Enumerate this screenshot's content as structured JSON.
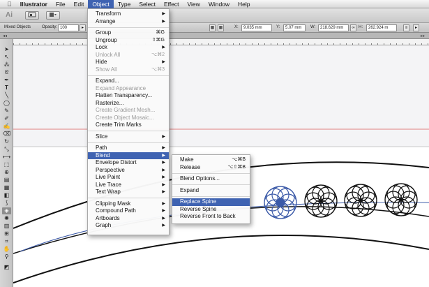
{
  "menubar": {
    "apple": "",
    "items": [
      "Illustrator",
      "File",
      "Edit",
      "Object",
      "Type",
      "Select",
      "Effect",
      "View",
      "Window",
      "Help"
    ],
    "active": "Object"
  },
  "appbar": {
    "logo": "Ai"
  },
  "controlbar": {
    "selection": "Mixed Objects",
    "opacity_label": "Opacity:",
    "opacity_value": "100",
    "x_label": "X:",
    "x_value": "9.035 mm",
    "y_label": "Y:",
    "y_value": "5.07 mm",
    "w_label": "W:",
    "w_value": "218.629 mm",
    "h_label": "H:",
    "h_value": "262.924 m"
  },
  "object_menu": {
    "transform": "Transform",
    "arrange": "Arrange",
    "group": "Group",
    "group_sc": "⌘G",
    "ungroup": "Ungroup",
    "ungroup_sc": "⇧⌘G",
    "lock": "Lock",
    "unlock_all": "Unlock All",
    "unlock_all_sc": "⌥⌘2",
    "hide": "Hide",
    "show_all": "Show All",
    "show_all_sc": "⌥⌘3",
    "expand": "Expand...",
    "expand_appearance": "Expand Appearance",
    "flatten_transparency": "Flatten Transparency...",
    "rasterize": "Rasterize...",
    "create_gradient_mesh": "Create Gradient Mesh...",
    "create_object_mosaic": "Create Object Mosaic...",
    "create_trim_marks": "Create Trim Marks",
    "slice": "Slice",
    "path": "Path",
    "blend": "Blend",
    "envelope_distort": "Envelope Distort",
    "perspective": "Perspective",
    "live_paint": "Live Paint",
    "live_trace": "Live Trace",
    "text_wrap": "Text Wrap",
    "clipping_mask": "Clipping Mask",
    "compound_path": "Compound Path",
    "artboards": "Artboards",
    "graph": "Graph"
  },
  "blend_menu": {
    "make": "Make",
    "make_sc": "⌥⌘B",
    "release": "Release",
    "release_sc": "⌥⇧⌘B",
    "blend_options": "Blend Options...",
    "expand": "Expand",
    "replace_spine": "Replace Spine",
    "reverse_spine": "Reverse Spine",
    "reverse_front_to_back": "Reverse Front to Back"
  },
  "colors": {
    "menu_highlight": "#3f63b2",
    "selection_blue": "#3b5aa8",
    "guide_red": "#e08080"
  }
}
